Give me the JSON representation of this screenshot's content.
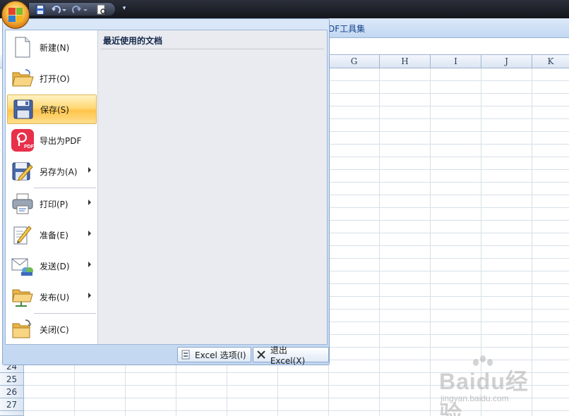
{
  "qat": {
    "save_icon": "save-icon",
    "undo_icon": "undo-icon",
    "redo_icon": "redo-icon",
    "preview_icon": "print-preview-icon",
    "customize_icon": "chevron-down-icon"
  },
  "ribbon": {
    "tab_fragment": "DF工具集"
  },
  "sheet": {
    "columns": [
      "G",
      "H",
      "I",
      "J",
      "K"
    ],
    "rows": [
      "24",
      "25",
      "26",
      "27"
    ]
  },
  "menu": {
    "recent_title": "最近使用的文档",
    "items": [
      {
        "label": "新建(N)",
        "icon": "new-document-icon"
      },
      {
        "label": "打开(O)",
        "icon": "open-folder-icon"
      },
      {
        "label": "保存(S)",
        "icon": "save-icon",
        "selected": true
      },
      {
        "label": "导出为PDF",
        "icon": "pdf-icon"
      },
      {
        "label": "另存为(A)",
        "icon": "save-as-icon",
        "submenu": true
      },
      {
        "label": "打印(P)",
        "icon": "printer-icon",
        "submenu": true
      },
      {
        "label": "准备(E)",
        "icon": "prepare-icon",
        "submenu": true
      },
      {
        "label": "发送(D)",
        "icon": "send-icon",
        "submenu": true
      },
      {
        "label": "发布(U)",
        "icon": "publish-icon",
        "submenu": true
      },
      {
        "label": "关闭(C)",
        "icon": "close-folder-icon"
      }
    ],
    "options_button": "Excel 选项(I)",
    "exit_button": "退出 Excel(X)"
  },
  "watermark": {
    "text": "Baidu经验",
    "sub": "jingyan.baidu.com"
  },
  "colors": {
    "selected_highlight": "#ffc44a",
    "menu_frame": "#c4d8f1",
    "recent_panel": "#e9ebf0",
    "grid_line": "#d7e0ea"
  }
}
